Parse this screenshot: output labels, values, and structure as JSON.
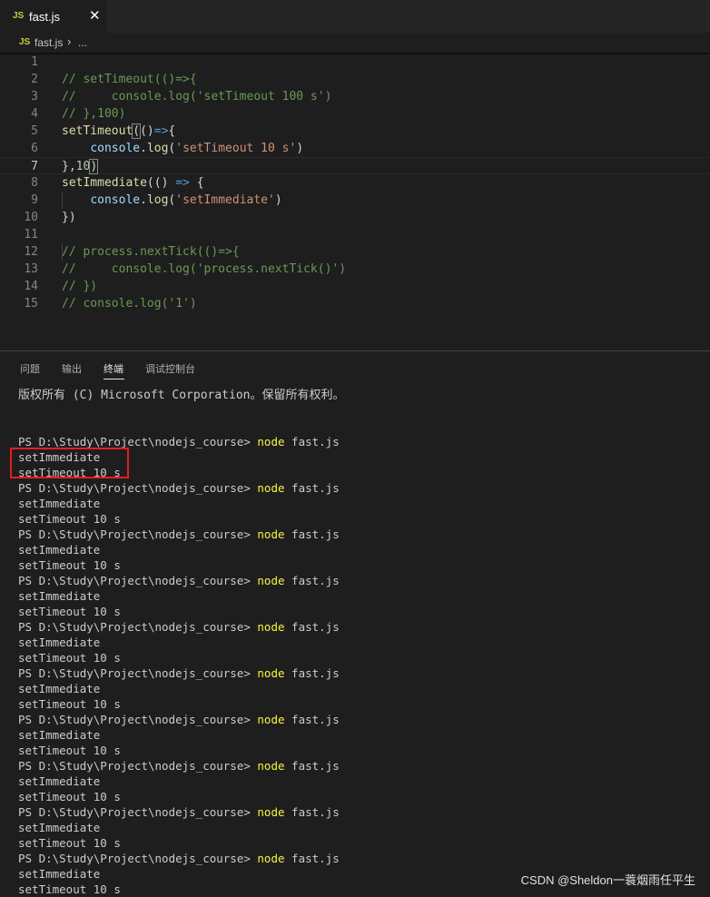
{
  "tab": {
    "icon": "JS",
    "label": "fast.js",
    "close": "✕"
  },
  "breadcrumb": {
    "icon": "JS",
    "file": "fast.js",
    "separator": "›",
    "more": "..."
  },
  "editor": {
    "active_line": 7,
    "lines": [
      {
        "n": "1",
        "tokens": []
      },
      {
        "n": "2",
        "tokens": [
          {
            "c": "t-com",
            "t": "// setTimeout(()=>{"
          }
        ]
      },
      {
        "n": "3",
        "tokens": [
          {
            "c": "t-com",
            "t": "//     console.log('setTimeout 100 s')"
          }
        ]
      },
      {
        "n": "4",
        "tokens": [
          {
            "c": "t-com",
            "t": "// },100)"
          }
        ]
      },
      {
        "n": "5",
        "tokens": [
          {
            "c": "t-fn",
            "t": "setTimeout"
          },
          {
            "c": "t-brk",
            "t": "("
          },
          {
            "c": "",
            "t": "()"
          },
          {
            "c": "t-arrow",
            "t": "=>"
          },
          {
            "c": "",
            "t": "{"
          }
        ]
      },
      {
        "n": "6",
        "tokens": [
          {
            "c": "",
            "t": "    "
          },
          {
            "c": "t-var",
            "t": "console"
          },
          {
            "c": "",
            "t": "."
          },
          {
            "c": "t-fn",
            "t": "log"
          },
          {
            "c": "",
            "t": "("
          },
          {
            "c": "t-str",
            "t": "'setTimeout 10 s'"
          },
          {
            "c": "",
            "t": ")"
          }
        ]
      },
      {
        "n": "7",
        "tokens": [
          {
            "c": "",
            "t": "},"
          },
          {
            "c": "t-num",
            "t": "10"
          },
          {
            "c": "t-brk",
            "t": ")"
          }
        ]
      },
      {
        "n": "8",
        "tokens": [
          {
            "c": "t-fn",
            "t": "setImmediate"
          },
          {
            "c": "",
            "t": "(() "
          },
          {
            "c": "t-arrow",
            "t": "=>"
          },
          {
            "c": "",
            "t": " {"
          }
        ]
      },
      {
        "n": "9",
        "tokens": [
          {
            "c": "",
            "t": "    "
          },
          {
            "c": "t-var",
            "t": "console"
          },
          {
            "c": "",
            "t": "."
          },
          {
            "c": "t-fn",
            "t": "log"
          },
          {
            "c": "",
            "t": "("
          },
          {
            "c": "t-str",
            "t": "'setImmediate'"
          },
          {
            "c": "",
            "t": ")"
          }
        ]
      },
      {
        "n": "10",
        "tokens": [
          {
            "c": "",
            "t": "})"
          }
        ]
      },
      {
        "n": "11",
        "tokens": []
      },
      {
        "n": "12",
        "tokens": [
          {
            "c": "t-com",
            "t": "// process.nextTick(()=>{"
          }
        ]
      },
      {
        "n": "13",
        "tokens": [
          {
            "c": "t-com",
            "t": "//     console.log('process.nextTick()')"
          }
        ]
      },
      {
        "n": "14",
        "tokens": [
          {
            "c": "t-com",
            "t": "// })"
          }
        ]
      },
      {
        "n": "15",
        "tokens": [
          {
            "c": "t-com",
            "t": "// console.log('1')"
          }
        ]
      }
    ]
  },
  "panel": {
    "tabs": [
      {
        "label": "问题",
        "active": false
      },
      {
        "label": "输出",
        "active": false
      },
      {
        "label": "终端",
        "active": true
      },
      {
        "label": "调试控制台",
        "active": false
      }
    ]
  },
  "terminal": {
    "copyright": "版权所有 (C) Microsoft Corporation。保留所有权利。",
    "prompt": "PS D:\\Study\\Project\\nodejs_course> ",
    "command": "node",
    "args": " fast.js",
    "runs": [
      [
        "setImmediate",
        "setTimeout 10 s"
      ],
      [
        "setImmediate",
        "setTimeout 10 s"
      ],
      [
        "setImmediate",
        "setTimeout 10 s"
      ],
      [
        "setImmediate",
        "setTimeout 10 s"
      ],
      [
        "setImmediate",
        "setTimeout 10 s"
      ],
      [
        "setImmediate",
        "setTimeout 10 s"
      ],
      [
        "setImmediate",
        "setTimeout 10 s"
      ],
      [
        "setImmediate",
        "setTimeout 10 s"
      ],
      [
        "setImmediate",
        "setTimeout 10 s"
      ],
      [
        "setImmediate",
        "setTimeout 10 s"
      ]
    ]
  },
  "watermark": "CSDN @Sheldon一蓑烟雨任平生",
  "colors": {
    "highlight_box": "#e51c23",
    "command": "#f5f543"
  }
}
